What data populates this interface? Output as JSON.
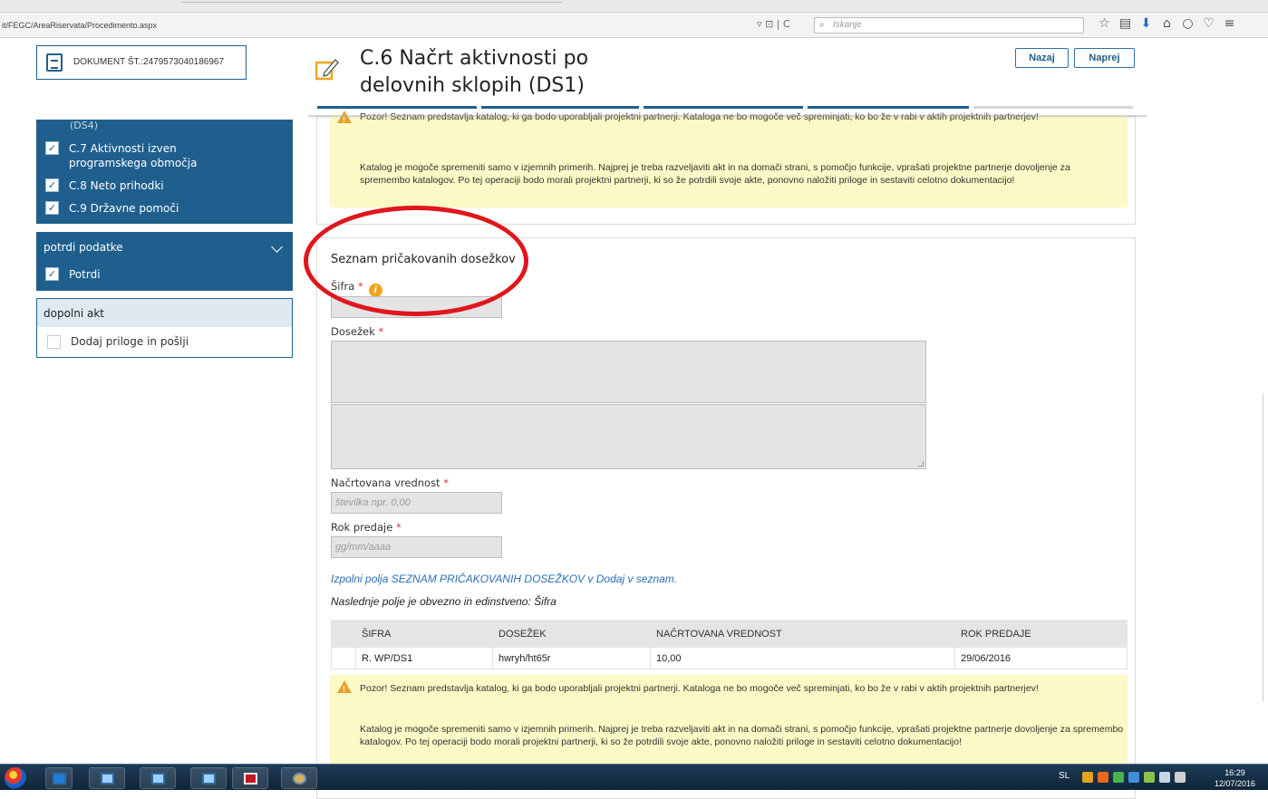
{
  "browser": {
    "url": "it/FEGC/AreaRiservata/Procedimento.aspx",
    "search_placeholder": "Iskanje",
    "url_tools": "▿ ⊡ | C"
  },
  "header": {
    "document_label": "DOKUMENT ŠT.:2479573040186967",
    "title": "C.6 Načrt aktivnosti po delovnih sklopih (DS1)",
    "back_label": "Nazaj",
    "next_label": "Naprej"
  },
  "sidebar": {
    "cut_item": "(DS4)",
    "items": [
      {
        "label": "C.7 Aktivnosti izven programskega območja",
        "checked": true
      },
      {
        "label": "C.8 Neto prihodki",
        "checked": true
      },
      {
        "label": "C.9 Državne pomoči",
        "checked": true
      }
    ],
    "confirm_header": "potrdi podatke",
    "confirm_item": "Potrdi",
    "extra_header": "dopolni akt",
    "extra_item": "Dodaj priloge in pošlji"
  },
  "warning": {
    "line1": "Pozor! Seznam predstavlja katalog, ki ga bodo uporabljali projektni partnerji. Kataloga ne bo mogoče več spreminjati, ko bo že v rabi v aktih projektnih partnerjev!",
    "line2": "Katalog je mogoče spremeniti samo v izjemnih primerih. Najprej je treba razveljaviti akt in na domači strani, s pomočjo funkcije, vprašati projektne partnerje dovoljenje za spremembo katalogov. Po tej operaciji bodo morali projektni partnerji, ki so že potrdili svoje akte, ponovno naložiti priloge in sestaviti celotno dokumentacijo!"
  },
  "form": {
    "section_title": "Seznam pričakovanih dosežkov",
    "sifra_label": "Šifra",
    "dosezek_label": "Dosežek",
    "vrednost_label": "Načrtovana vrednost",
    "vrednost_placeholder": "številka npr. 0,00",
    "rok_label": "Rok predaje",
    "rok_placeholder": "gg/mm/aaaa",
    "required_mark": "*",
    "info_mark": "i",
    "instruction_link": "Izpolni polja SEZNAM PRIČAKOVANIH DOSEŽKOV v Dodaj v seznam.",
    "note": "Naslednje polje je obvezno in edinstveno: Šifra"
  },
  "table": {
    "headers": [
      "",
      "ŠIFRA",
      "DOSEŽEK",
      "NAČRTOVANA VREDNOST",
      "ROK PREDAJE"
    ],
    "rows": [
      [
        "",
        "R. WP/DS1",
        "hwryh/ht65r",
        "10,00",
        "29/06/2016"
      ]
    ]
  },
  "taskbar": {
    "language": "SL",
    "time": "16:29",
    "date": "12/07/2016"
  },
  "colors": {
    "primary": "#1f5f8d",
    "warning_bg": "#fbfac6",
    "annotation": "#e0161d",
    "required": "#d9313a",
    "link": "#2b6fb3"
  }
}
